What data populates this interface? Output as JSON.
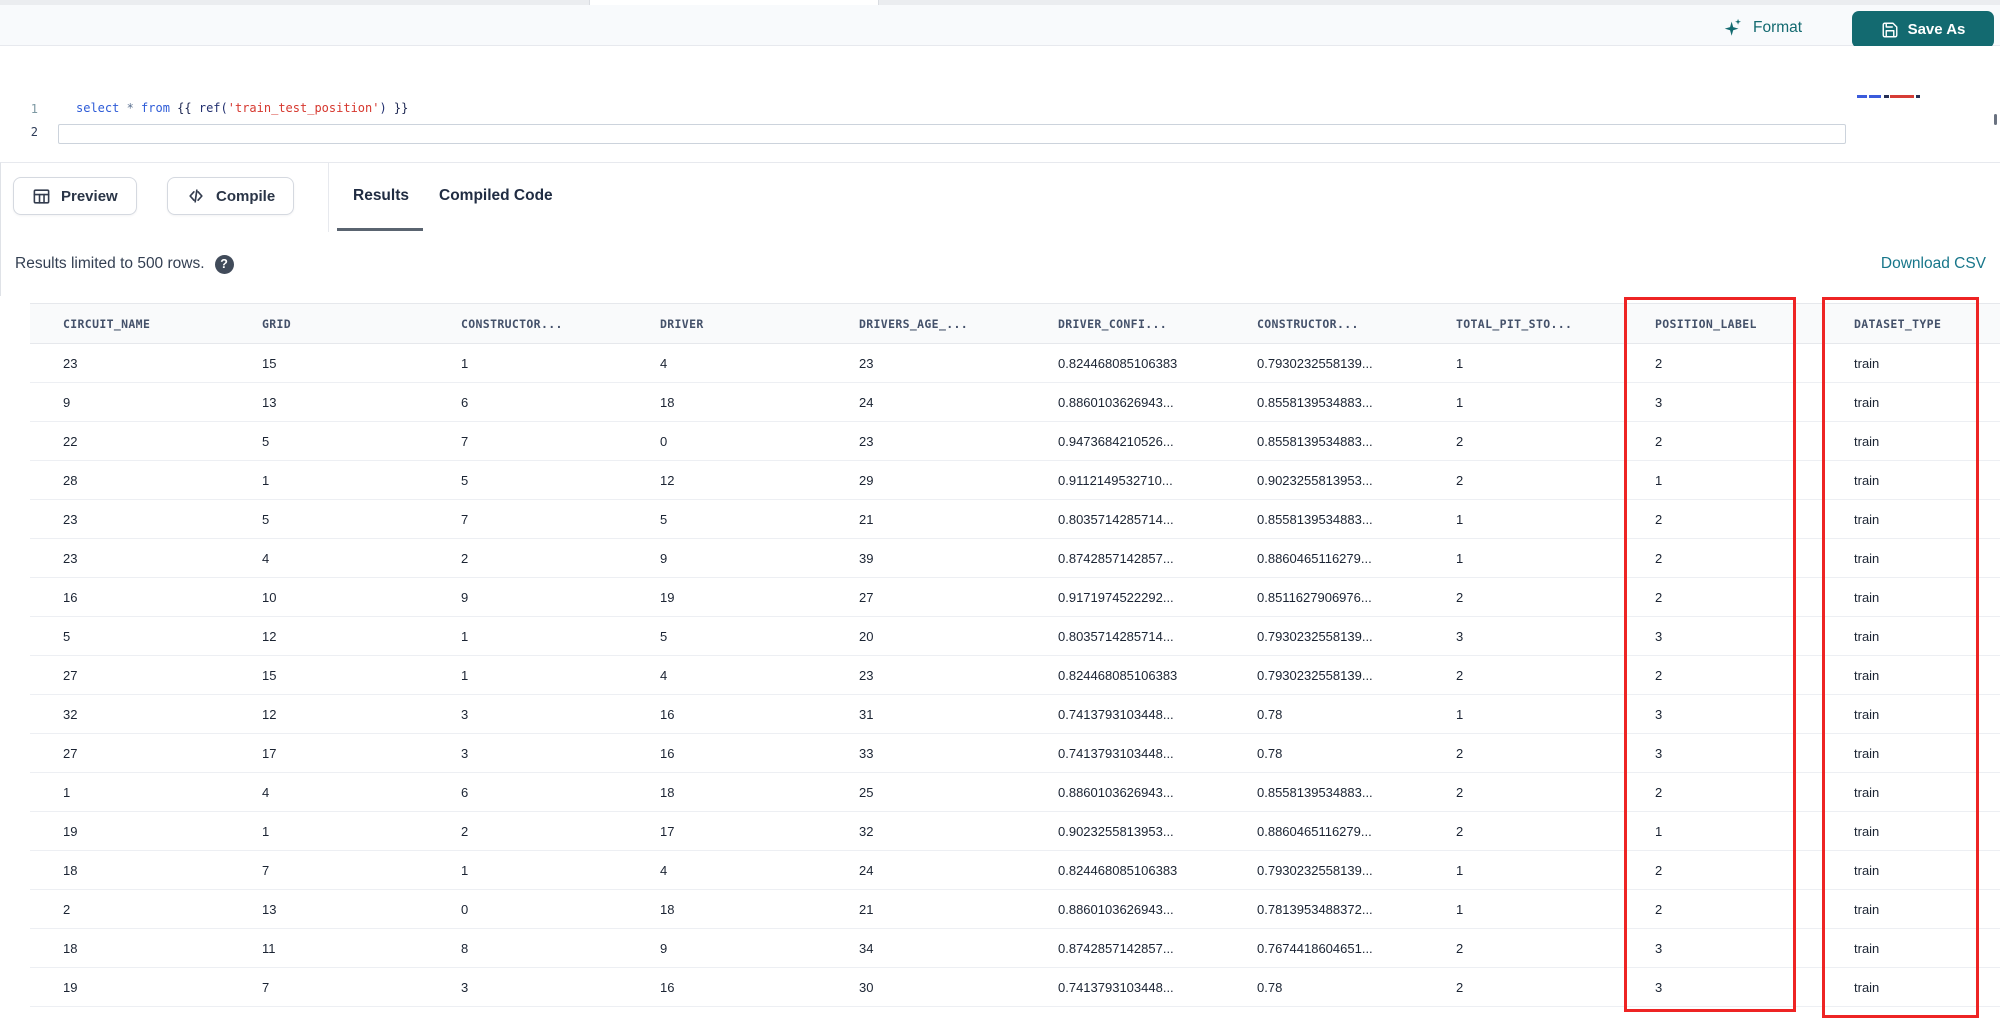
{
  "toolbar": {
    "format_label": "Format",
    "save_as_label": "Save As"
  },
  "editor": {
    "line_numbers": {
      "n1": "1",
      "n2": "2"
    },
    "code": {
      "kw_select": "select ",
      "star": "* ",
      "kw_from": "from ",
      "jinja_open": "{{ ",
      "ref_call": "ref(",
      "string_arg": "'train_test_position'",
      "paren_close": ") ",
      "jinja_close": "}}"
    }
  },
  "actions": {
    "preview_label": "Preview",
    "compile_label": "Compile"
  },
  "tabs": [
    {
      "label": "Results",
      "active": true
    },
    {
      "label": "Compiled Code",
      "active": false
    }
  ],
  "results_bar": {
    "info_text": "Results limited to 500 rows.",
    "download_label": "Download CSV"
  },
  "table": {
    "columns": [
      "CIRCUIT_NAME",
      "GRID",
      "CONSTRUCTOR...",
      "DRIVER",
      "DRIVERS_AGE_...",
      "DRIVER_CONFI...",
      "CONSTRUCTOR...",
      "TOTAL_PIT_STO...",
      "POSITION_LABEL",
      "DATASET_TYPE"
    ],
    "rows": [
      [
        "23",
        "15",
        "1",
        "4",
        "23",
        "0.824468085106383",
        "0.7930232558139...",
        "1",
        "2",
        "train"
      ],
      [
        "9",
        "13",
        "6",
        "18",
        "24",
        "0.8860103626943...",
        "0.8558139534883...",
        "1",
        "3",
        "train"
      ],
      [
        "22",
        "5",
        "7",
        "0",
        "23",
        "0.9473684210526...",
        "0.8558139534883...",
        "2",
        "2",
        "train"
      ],
      [
        "28",
        "1",
        "5",
        "12",
        "29",
        "0.9112149532710...",
        "0.9023255813953...",
        "2",
        "1",
        "train"
      ],
      [
        "23",
        "5",
        "7",
        "5",
        "21",
        "0.8035714285714...",
        "0.8558139534883...",
        "1",
        "2",
        "train"
      ],
      [
        "23",
        "4",
        "2",
        "9",
        "39",
        "0.8742857142857...",
        "0.8860465116279...",
        "1",
        "2",
        "train"
      ],
      [
        "16",
        "10",
        "9",
        "19",
        "27",
        "0.9171974522292...",
        "0.8511627906976...",
        "2",
        "2",
        "train"
      ],
      [
        "5",
        "12",
        "1",
        "5",
        "20",
        "0.8035714285714...",
        "0.7930232558139...",
        "3",
        "3",
        "train"
      ],
      [
        "27",
        "15",
        "1",
        "4",
        "23",
        "0.824468085106383",
        "0.7930232558139...",
        "2",
        "2",
        "train"
      ],
      [
        "32",
        "12",
        "3",
        "16",
        "31",
        "0.7413793103448...",
        "0.78",
        "1",
        "3",
        "train"
      ],
      [
        "27",
        "17",
        "3",
        "16",
        "33",
        "0.7413793103448...",
        "0.78",
        "2",
        "3",
        "train"
      ],
      [
        "1",
        "4",
        "6",
        "18",
        "25",
        "0.8860103626943...",
        "0.8558139534883...",
        "2",
        "2",
        "train"
      ],
      [
        "19",
        "1",
        "2",
        "17",
        "32",
        "0.9023255813953...",
        "0.8860465116279...",
        "2",
        "1",
        "train"
      ],
      [
        "18",
        "7",
        "1",
        "4",
        "24",
        "0.824468085106383",
        "0.7930232558139...",
        "1",
        "2",
        "train"
      ],
      [
        "2",
        "13",
        "0",
        "18",
        "21",
        "0.8860103626943...",
        "0.7813953488372...",
        "1",
        "2",
        "train"
      ],
      [
        "18",
        "11",
        "8",
        "9",
        "34",
        "0.8742857142857...",
        "0.7674418604651...",
        "2",
        "3",
        "train"
      ],
      [
        "19",
        "7",
        "3",
        "16",
        "30",
        "0.7413793103448...",
        "0.78",
        "2",
        "3",
        "train"
      ]
    ]
  },
  "annotations": {
    "boxed_columns": [
      "POSITION_LABEL",
      "DATASET_TYPE"
    ],
    "box_color": "#ee2424"
  },
  "icons": {
    "format": "sparkles",
    "save_as": "floppy-disk",
    "preview": "table-grid",
    "compile": "code-brackets",
    "help": "question-mark-circle"
  },
  "colors": {
    "accent_teal": "#136a70",
    "link_teal": "#17768a",
    "annotation_red": "#ee2424"
  }
}
